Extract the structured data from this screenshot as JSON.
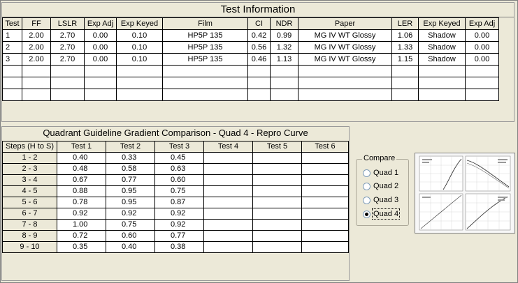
{
  "info": {
    "title": "Test Information",
    "headers": [
      "Test",
      "FF",
      "LSLR",
      "Exp Adj",
      "Exp Keyed",
      "Film",
      "CI",
      "NDR",
      "Paper",
      "LER",
      "Exp Keyed",
      "Exp Adj"
    ],
    "rows": [
      [
        "1",
        "2.00",
        "2.70",
        "0.00",
        "0.10",
        "HP5P 135",
        "0.42",
        "0.99",
        "MG IV WT Glossy",
        "1.06",
        "Shadow",
        "0.00"
      ],
      [
        "2",
        "2.00",
        "2.70",
        "0.00",
        "0.10",
        "HP5P 135",
        "0.56",
        "1.32",
        "MG IV WT Glossy",
        "1.33",
        "Shadow",
        "0.00"
      ],
      [
        "3",
        "2.00",
        "2.70",
        "0.00",
        "0.10",
        "HP5P 135",
        "0.46",
        "1.13",
        "MG IV WT Glossy",
        "1.15",
        "Shadow",
        "0.00"
      ]
    ]
  },
  "quad": {
    "title": "Quadrant Guideline Gradient Comparison - Quad 4 - Repro Curve",
    "headers": [
      "Steps (H to S)",
      "Test 1",
      "Test 2",
      "Test 3",
      "Test 4",
      "Test 5",
      "Test 6"
    ],
    "rows": [
      [
        "1 - 2",
        "0.40",
        "0.33",
        "0.45",
        "",
        "",
        ""
      ],
      [
        "2 - 3",
        "0.48",
        "0.58",
        "0.63",
        "",
        "",
        ""
      ],
      [
        "3 - 4",
        "0.67",
        "0.77",
        "0.60",
        "",
        "",
        ""
      ],
      [
        "4 - 5",
        "0.88",
        "0.95",
        "0.75",
        "",
        "",
        ""
      ],
      [
        "5 - 6",
        "0.78",
        "0.95",
        "0.87",
        "",
        "",
        ""
      ],
      [
        "6 - 7",
        "0.92",
        "0.92",
        "0.92",
        "",
        "",
        ""
      ],
      [
        "7 - 8",
        "1.00",
        "0.75",
        "0.92",
        "",
        "",
        ""
      ],
      [
        "8 - 9",
        "0.72",
        "0.60",
        "0.77",
        "",
        "",
        ""
      ],
      [
        "9 - 10",
        "0.35",
        "0.40",
        "0.38",
        "",
        "",
        ""
      ]
    ]
  },
  "compare": {
    "legend": "Compare",
    "options": [
      "Quad 1",
      "Quad 2",
      "Quad 3",
      "Quad 4"
    ],
    "selected": "Quad 4"
  },
  "thumbnail": {
    "icon": "quadrant-chart-thumbnail"
  },
  "colors": {
    "window_bg": "#ece9d8",
    "grid_bg": "#ffffff",
    "grid_line": "#000000"
  }
}
